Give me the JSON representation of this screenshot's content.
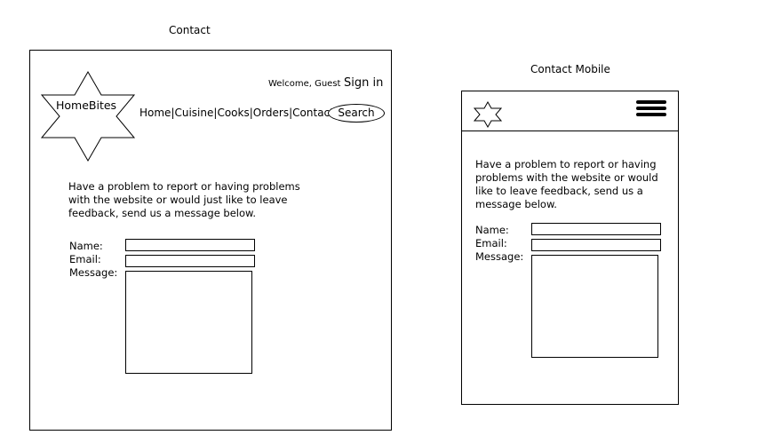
{
  "desktop": {
    "caption": "Contact",
    "welcome": "Welcome, Guest",
    "sign_in": "Sign in",
    "logo_text": "HomeBites",
    "nav": [
      {
        "label": "Home"
      },
      {
        "label": "Cuisine"
      },
      {
        "label": "Cooks"
      },
      {
        "label": "Orders"
      },
      {
        "label": "Contact"
      }
    ],
    "nav_separator": "|",
    "search_label": "Search",
    "intro_lines": [
      "Have a problem to report or having problems",
      "with the website or would just like to leave",
      "feedback, send us a message below."
    ],
    "form": {
      "name_label": "Name:",
      "email_label": "Email:",
      "message_label": "Message:"
    }
  },
  "mobile": {
    "caption": "Contact Mobile",
    "intro_lines": [
      "Have a problem to report or having",
      "problems with the website or would",
      "like to leave feedback, send us a",
      "message below."
    ],
    "form": {
      "name_label": "Name:",
      "email_label": "Email:",
      "message_label": "Message:"
    },
    "menu_icon": "hamburger-icon",
    "logo_icon": "star-icon"
  }
}
